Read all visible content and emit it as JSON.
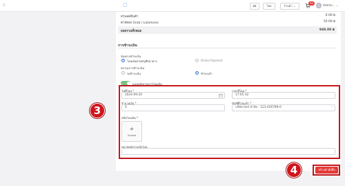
{
  "topbar": {
    "logo_glyph": "▢",
    "menu_glyph": "⁝⁝",
    "currency": "฿฿",
    "language": "ไทย",
    "shop_menu": "ร้านค้า",
    "cart_badge": "99",
    "username": "Admin...",
    "caret": "⌄"
  },
  "summary": {
    "rows": [
      {
        "label": "ส่วนลดสินค้า",
        "value": "0.00 ฿"
      },
      {
        "label": "ค่าจัดส่ง Grab / Lalamove",
        "value": "50.00 ฿"
      }
    ],
    "total_label": "ยอดรวมทั้งหมด",
    "total_value": "949.00 ฿"
  },
  "payment": {
    "section_title": "การชำระเงิน",
    "method_label": "ช่องทางชำระเงิน",
    "method_options": [
      "โอนเงินผ่านบัญชีธนาคาร",
      "Online Payment"
    ],
    "status_label": "สถานะการชำระเงิน",
    "status_options": [
      "รอชำระเงิน",
      "ชำระแล้ว"
    ],
    "toggle_label": "แนบหลักฐานการโอนเงิน",
    "date_label": "วันที่โอน *",
    "date_value": "2024-09-20",
    "time_label": "เวลาที่โอน *",
    "time_value": "17:05:32",
    "amount_label": "จำนวนเงิน *",
    "amount_value": "0",
    "account_label": "บัญชีที่โอนเข้า *",
    "account_value": "บริษัท test จำกัด - 123-456789-0",
    "slip_label": "สลิปโอนเงิน *",
    "upload_plus": "+",
    "upload_label": "Upload",
    "note_label": "หมายเหตุการแจ้งโอน"
  },
  "actions": {
    "submit_label": "สร้างคำสั่งซื้อ"
  },
  "annotations": {
    "step3": "3",
    "step4": "4"
  },
  "colors": {
    "accent": "#e53935",
    "annotation_red": "#c4161c",
    "radio_blue": "#2f6fd6"
  }
}
